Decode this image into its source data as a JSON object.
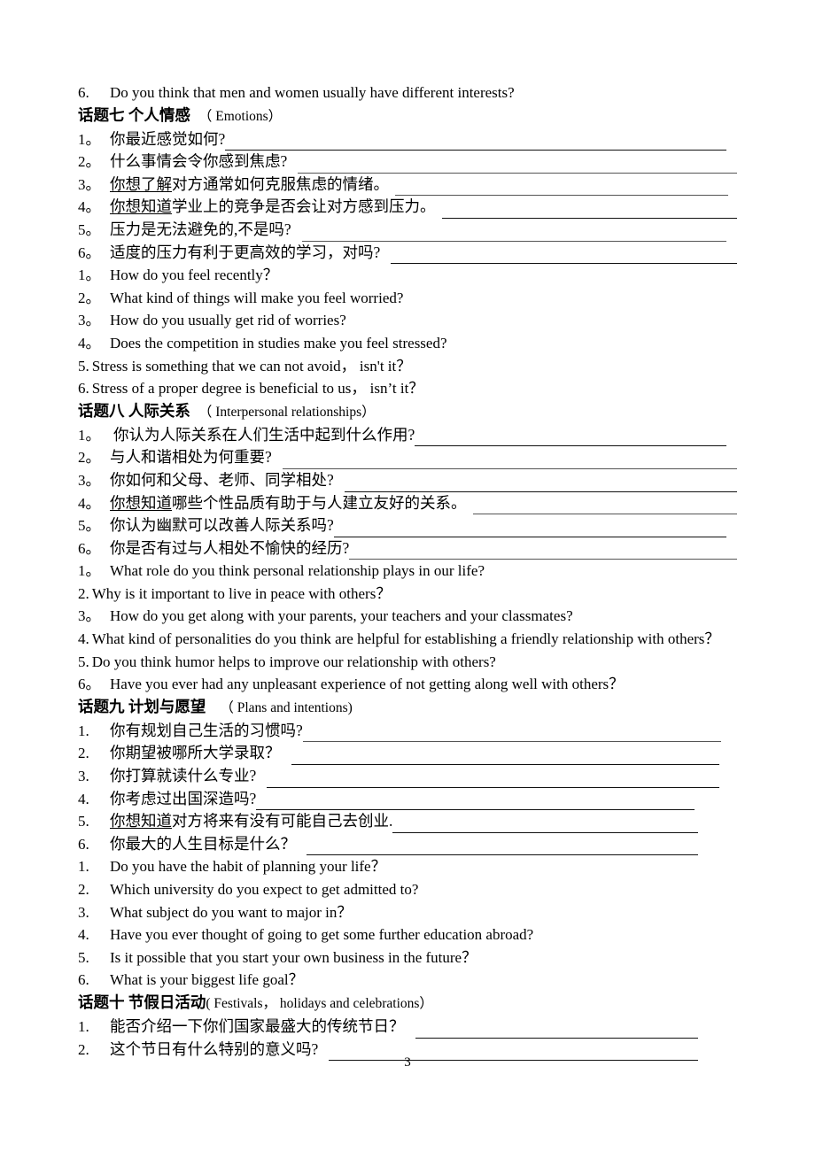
{
  "document": {
    "page_number": "3",
    "lead_question": {
      "num": "6.",
      "text": "Do you think that men and women usually have different interests?"
    }
  },
  "topics": [
    {
      "heading_cn": "话题七 个人情感",
      "heading_en": "（ Emotions）",
      "items_cn": [
        {
          "num": "1。",
          "text": "你最近感觉如何?"
        },
        {
          "num": "2。",
          "text": "什么事情会令你感到焦虑?"
        },
        {
          "num": "3。",
          "text_underlined": "你想了解",
          "text": "对方通常如何克服焦虑的情绪。"
        },
        {
          "num": "4。",
          "text_underlined": "你想知道",
          "text": "学业上的竞争是否会让对方感到压力。"
        },
        {
          "num": "5。",
          "text": "压力是无法避免的,不是吗?"
        },
        {
          "num": "6。",
          "text": "适度的压力有利于更高效的学习，对吗?"
        }
      ],
      "items_en": [
        {
          "num": "1。",
          "text": "How do you feel recently？"
        },
        {
          "num": "2。",
          "text": "What kind of things will make you feel worried?"
        },
        {
          "num": "3。",
          "text": "How do you usually get rid of worries?"
        },
        {
          "num": "4。",
          "text": "Does the competition in studies make you feel stressed?"
        },
        {
          "num": "5.",
          "text": "Stress is something that we can not avoid，  isn't it？"
        },
        {
          "num": "6.",
          "text": "Stress of a proper degree is beneficial to us，  isn’t it？"
        }
      ]
    },
    {
      "heading_cn": "话题八 人际关系",
      "heading_en": "（ Interpersonal relationships）",
      "items_cn": [
        {
          "num": "1。",
          "text": "你认为人际关系在人们生活中起到什么作用?"
        },
        {
          "num": "2。",
          "text": "与人和谐相处为何重要?"
        },
        {
          "num": "3。",
          "text": "你如何和父母、老师、同学相处?"
        },
        {
          "num": "4。",
          "text_underlined": "你想知道",
          "text": "哪些个性品质有助于与人建立友好的关系。"
        },
        {
          "num": "5。",
          "text": "你认为幽默可以改善人际关系吗?"
        },
        {
          "num": "6。",
          "text": "你是否有过与人相处不愉快的经历?"
        }
      ],
      "items_en": [
        {
          "num": "1。",
          "text": "What role do you think personal relationship plays in our life?"
        },
        {
          "num": "2.",
          "text": "Why is it important to live in peace with others？"
        },
        {
          "num": "3。",
          "text": "How do you get along with your parents, your teachers and your classmates?"
        },
        {
          "num": "4.",
          "text": "What kind of personalities do you think are helpful for establishing a friendly relationship with others？"
        },
        {
          "num": "5.",
          "text": "Do you think humor helps to improve our relationship with others?"
        },
        {
          "num": "6。",
          "text": "Have you ever had any unpleasant experience of not getting along well with others？"
        }
      ]
    },
    {
      "heading_cn": "话题九 计划与愿望",
      "heading_en": "（ Plans and intentions)",
      "items_cn": [
        {
          "num": "1.",
          "text": "你有规划自己生活的习惯吗?"
        },
        {
          "num": "2.",
          "text": "你期望被哪所大学录取？"
        },
        {
          "num": "3.",
          "text": "你打算就读什么专业?"
        },
        {
          "num": "4.",
          "text": "你考虑过出国深造吗?"
        },
        {
          "num": "5.",
          "text_underlined": "你想知道",
          "text": "对方将来有没有可能自己去创业."
        },
        {
          "num": "6.",
          "text": "你最大的人生目标是什么？"
        }
      ],
      "items_en": [
        {
          "num": "1.",
          "text": "Do you have the habit of planning your life？"
        },
        {
          "num": "2.",
          "text": "Which university do you expect to get admitted to?"
        },
        {
          "num": "3.",
          "text": "What subject do you want to major in？"
        },
        {
          "num": "4.",
          "text": "Have you ever thought of going to get some further education abroad?"
        },
        {
          "num": "5.",
          "text": "Is it possible that you start your own business in the future？"
        },
        {
          "num": "6.",
          "text": "What is your biggest life goal？"
        }
      ]
    },
    {
      "heading_cn": "话题十 节假日活动",
      "heading_en": "( Festivals，  holidays and celebrations）",
      "items_cn": [
        {
          "num": "1.",
          "text": "能否介绍一下你们国家最盛大的传统节日？"
        },
        {
          "num": "2.",
          "text": "这个节日有什么特别的意义吗?"
        }
      ],
      "items_en": []
    }
  ]
}
